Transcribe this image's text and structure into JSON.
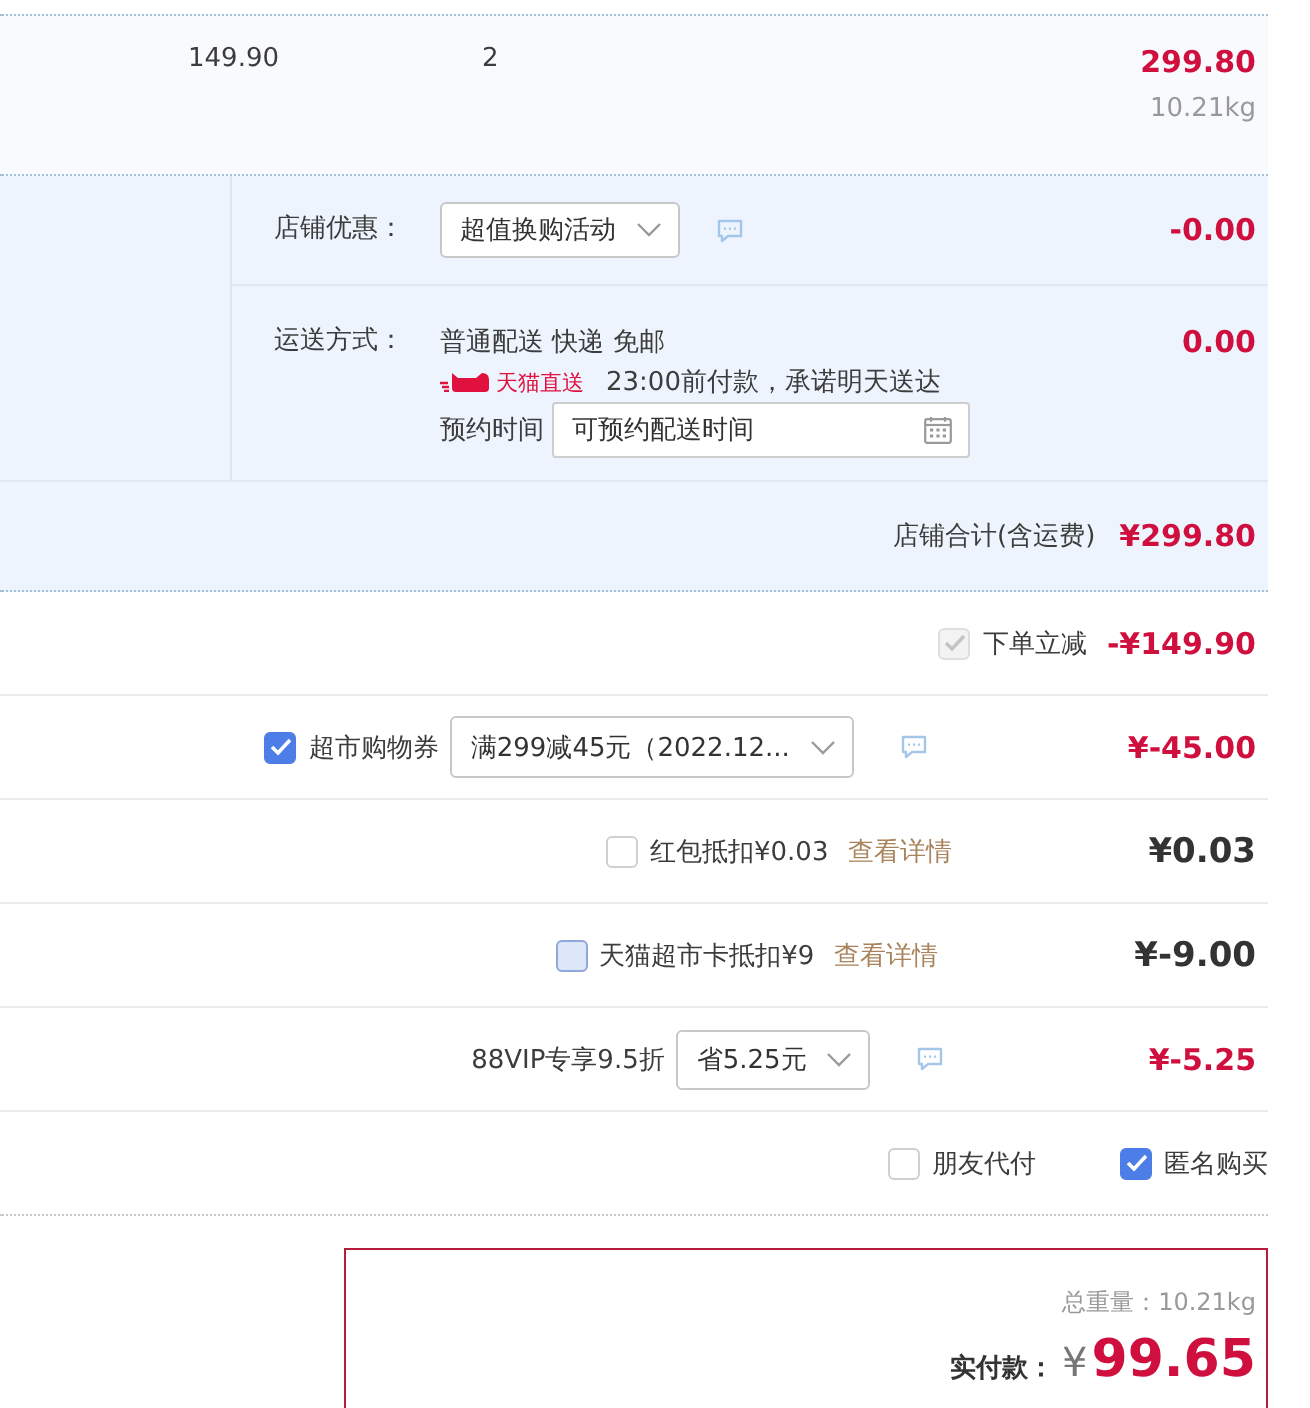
{
  "item_row": {
    "price": "149.90",
    "quantity": "2",
    "subtotal": "299.80",
    "weight": "10.21kg"
  },
  "shop": {
    "promotion": {
      "label": "店铺优惠：",
      "option": "超值换购活动",
      "amount": "-0.00"
    },
    "shipping": {
      "label": "运送方式：",
      "method": "普通配送 快递 免邮",
      "service_badge": "天猫直送",
      "promise": "23:00前付款，承诺明天送达",
      "appointment_label": "预约时间",
      "appointment_field": {
        "placeholder": "可预约配送时间"
      },
      "amount": "0.00"
    },
    "total": {
      "label": "店铺合计(含运费)",
      "amount": "¥299.80"
    }
  },
  "adjustments": [
    {
      "kind": "instant",
      "checkbox": {
        "checked": true,
        "disabled": true,
        "hovered": false
      },
      "label": "下单立减",
      "amount": "-¥149.90"
    },
    {
      "kind": "coupon",
      "checkbox": {
        "checked": true,
        "disabled": false,
        "hovered": false
      },
      "label": "超市购物券",
      "option": "满299减45元（2022.12...",
      "amount": "¥-45.00"
    },
    {
      "kind": "deduction",
      "checkbox": {
        "checked": false,
        "disabled": false,
        "hovered": false
      },
      "label": "红包抵扣¥0.03",
      "link": "查看详情",
      "amount": "¥0.03"
    },
    {
      "kind": "deduction",
      "checkbox": {
        "checked": false,
        "disabled": false,
        "hovered": true
      },
      "label": "天猫超市卡抵扣¥9",
      "link": "查看详情",
      "amount": "¥-9.00"
    },
    {
      "kind": "vip",
      "label": "88VIP专享9.5折",
      "option": "省5.25元",
      "amount": "¥-5.25"
    }
  ],
  "options": [
    {
      "label": "朋友代付",
      "checked": false
    },
    {
      "label": "匿名购买",
      "checked": true
    }
  ],
  "summary": {
    "weight": "总重量：10.21kg",
    "pay_label": "实付款：",
    "currency": "¥",
    "amount": "99.65"
  }
}
